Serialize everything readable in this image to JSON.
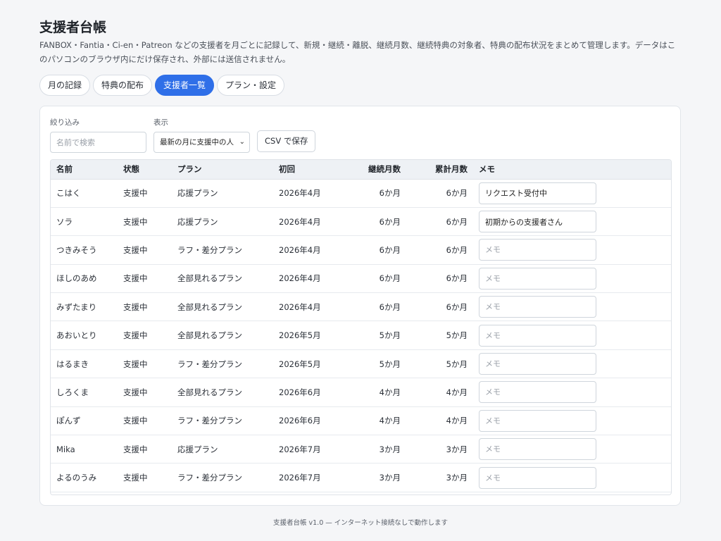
{
  "app": {
    "title": "支援者台帳",
    "description": "FANBOX・Fantia・Ci-en・Patreon などの支援者を月ごとに記録して、新規・継続・離脱、継続月数、継続特典の対象者、特典の配布状況をまとめて管理します。データはこのパソコンのブラウザ内にだけ保存され、外部には送信されません。"
  },
  "tabs": [
    {
      "label": "月の記録",
      "active": false
    },
    {
      "label": "特典の配布",
      "active": false
    },
    {
      "label": "支援者一覧",
      "active": true
    },
    {
      "label": "プラン・設定",
      "active": false
    }
  ],
  "filter": {
    "label": "絞り込み",
    "search_placeholder": "名前で検索",
    "search_value": ""
  },
  "display": {
    "label": "表示",
    "selected": "最新の月に支援中の人"
  },
  "csv_button": "CSV で保存",
  "table": {
    "headers": [
      "名前",
      "状態",
      "プラン",
      "初回",
      "継続月数",
      "累計月数",
      "メモ"
    ],
    "rows": [
      {
        "name": "こはく",
        "status": "支援中",
        "plan": "応援プラン",
        "first": "2026年4月",
        "streak": "6か月",
        "total": "6か月",
        "memo": "リクエスト受付中"
      },
      {
        "name": "ソラ",
        "status": "支援中",
        "plan": "応援プラン",
        "first": "2026年4月",
        "streak": "6か月",
        "total": "6か月",
        "memo": "初期からの支援者さん"
      },
      {
        "name": "つきみそう",
        "status": "支援中",
        "plan": "ラフ・差分プラン",
        "first": "2026年4月",
        "streak": "6か月",
        "total": "6か月",
        "memo": ""
      },
      {
        "name": "ほしのあめ",
        "status": "支援中",
        "plan": "全部見れるプラン",
        "first": "2026年4月",
        "streak": "6か月",
        "total": "6か月",
        "memo": ""
      },
      {
        "name": "みずたまり",
        "status": "支援中",
        "plan": "全部見れるプラン",
        "first": "2026年4月",
        "streak": "6か月",
        "total": "6か月",
        "memo": ""
      },
      {
        "name": "あおいとり",
        "status": "支援中",
        "plan": "全部見れるプラン",
        "first": "2026年5月",
        "streak": "5か月",
        "total": "5か月",
        "memo": ""
      },
      {
        "name": "はるまき",
        "status": "支援中",
        "plan": "ラフ・差分プラン",
        "first": "2026年5月",
        "streak": "5か月",
        "total": "5か月",
        "memo": ""
      },
      {
        "name": "しろくま",
        "status": "支援中",
        "plan": "全部見れるプラン",
        "first": "2026年6月",
        "streak": "4か月",
        "total": "4か月",
        "memo": ""
      },
      {
        "name": "ぽんず",
        "status": "支援中",
        "plan": "ラフ・差分プラン",
        "first": "2026年6月",
        "streak": "4か月",
        "total": "4か月",
        "memo": ""
      },
      {
        "name": "Mika",
        "status": "支援中",
        "plan": "応援プラン",
        "first": "2026年7月",
        "streak": "3か月",
        "total": "3か月",
        "memo": ""
      },
      {
        "name": "よるのうみ",
        "status": "支援中",
        "plan": "ラフ・差分プラン",
        "first": "2026年7月",
        "streak": "3か月",
        "total": "3か月",
        "memo": ""
      }
    ],
    "memo_placeholder": "メモ"
  },
  "footer": "支援者台帳 v1.0 — インターネット接続なしで動作します",
  "colors": {
    "accent": "#2f6fe8",
    "background": "#f5f6f8"
  }
}
